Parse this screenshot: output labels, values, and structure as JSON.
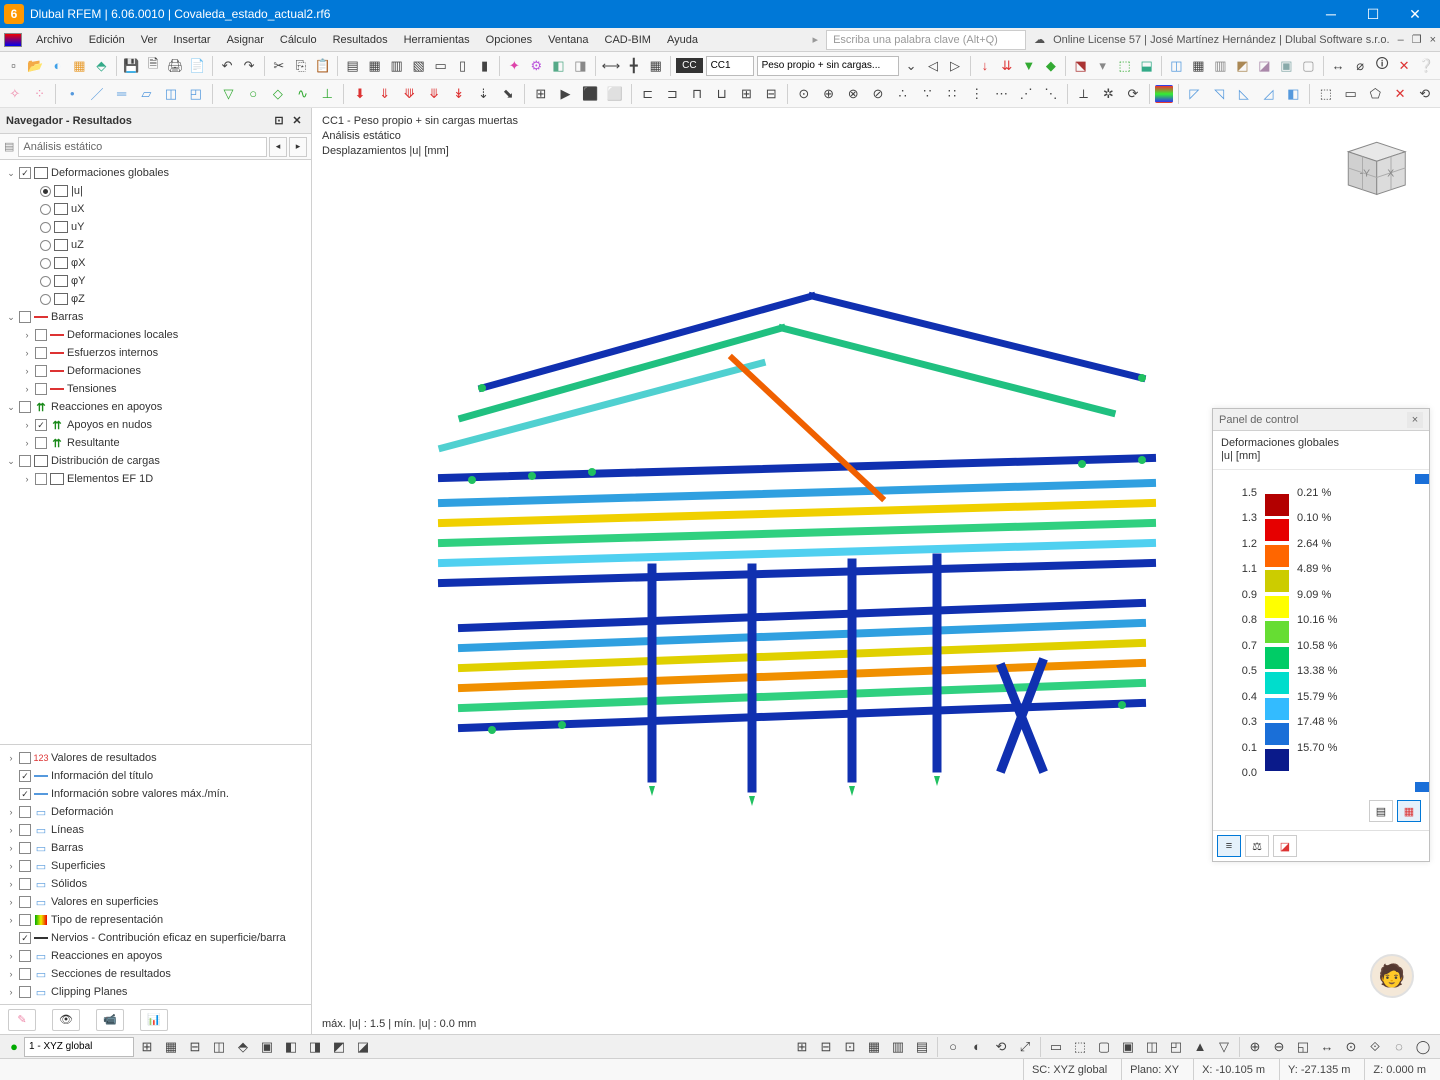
{
  "title": "Dlubal RFEM | 6.06.0010 | Covaleda_estado_actual2.rf6",
  "license": "Online License 57 | José Martínez Hernández | Dlubal Software s.r.o.",
  "menus": [
    "Archivo",
    "Edición",
    "Ver",
    "Insertar",
    "Asignar",
    "Cálculo",
    "Resultados",
    "Herramientas",
    "Opciones",
    "Ventana",
    "CAD-BIM",
    "Ayuda"
  ],
  "search_placeholder": "Escriba una palabra clave (Alt+Q)",
  "toolbar2": {
    "cc_label": "CC",
    "cc_value": "CC1",
    "case_value": "Peso propio + sin cargas..."
  },
  "navigator": {
    "title": "Navegador - Resultados",
    "combo": "Análisis estático",
    "tree": {
      "deform_glob": "Deformaciones globales",
      "u": "|u|",
      "ux": "uX",
      "uy": "uY",
      "uz": "uZ",
      "phix": "φX",
      "phiy": "φY",
      "phiz": "φZ",
      "barras": "Barras",
      "def_loc": "Deformaciones locales",
      "esf_int": "Esfuerzos internos",
      "deform": "Deformaciones",
      "tens": "Tensiones",
      "reac": "Reacciones en apoyos",
      "ap_nudos": "Apoyos en nudos",
      "resultante": "Resultante",
      "dist_cargas": "Distribución de cargas",
      "ef1d": "Elementos EF 1D"
    },
    "bottom": {
      "val_res": "Valores de resultados",
      "info_tit": "Información del título",
      "info_max": "Información sobre valores máx./mín.",
      "deform": "Deformación",
      "lineas": "Líneas",
      "barras": "Barras",
      "superf": "Superficies",
      "solidos": "Sólidos",
      "val_sup": "Valores en superficies",
      "tipo_rep": "Tipo de representación",
      "nervios": "Nervios - Contribución eficaz en superficie/barra",
      "reac_ap": "Reacciones en apoyos",
      "secc": "Secciones de resultados",
      "clip": "Clipping Planes"
    }
  },
  "viewport": {
    "line1": "CC1 - Peso propio + sin cargas muertas",
    "line2": "Análisis estático",
    "line3": "Desplazamientos |u| [mm]",
    "footer": "máx. |u| : 1.5 | mín. |u| : 0.0 mm"
  },
  "panel": {
    "title": "Panel de control",
    "sub1": "Deformaciones globales",
    "sub2": "|u| [mm]",
    "scale": [
      {
        "v": "1.5",
        "c": "#b30000",
        "p": "0.21 %"
      },
      {
        "v": "1.3",
        "c": "#e60000",
        "p": "0.10 %"
      },
      {
        "v": "1.2",
        "c": "#ff6600",
        "p": "2.64 %"
      },
      {
        "v": "1.1",
        "c": "#cccc00",
        "p": "4.89 %"
      },
      {
        "v": "0.9",
        "c": "#ffff00",
        "p": "9.09 %"
      },
      {
        "v": "0.8",
        "c": "#66dd33",
        "p": "10.16 %"
      },
      {
        "v": "0.7",
        "c": "#00cc66",
        "p": "10.58 %"
      },
      {
        "v": "0.5",
        "c": "#00ddcc",
        "p": "13.38 %"
      },
      {
        "v": "0.4",
        "c": "#33bbff",
        "p": "15.79 %"
      },
      {
        "v": "0.3",
        "c": "#1a6fd8",
        "p": "17.48 %"
      },
      {
        "v": "0.1",
        "c": "#0a1a8a",
        "p": "15.70 %"
      },
      {
        "v": "0.0",
        "c": "",
        "p": ""
      }
    ]
  },
  "status": {
    "view": "1 - XYZ global",
    "sc": "SC: XYZ global",
    "plano": "Plano: XY",
    "x": "X: -10.105 m",
    "y": "Y: -27.135 m",
    "z": "Z: 0.000 m"
  }
}
